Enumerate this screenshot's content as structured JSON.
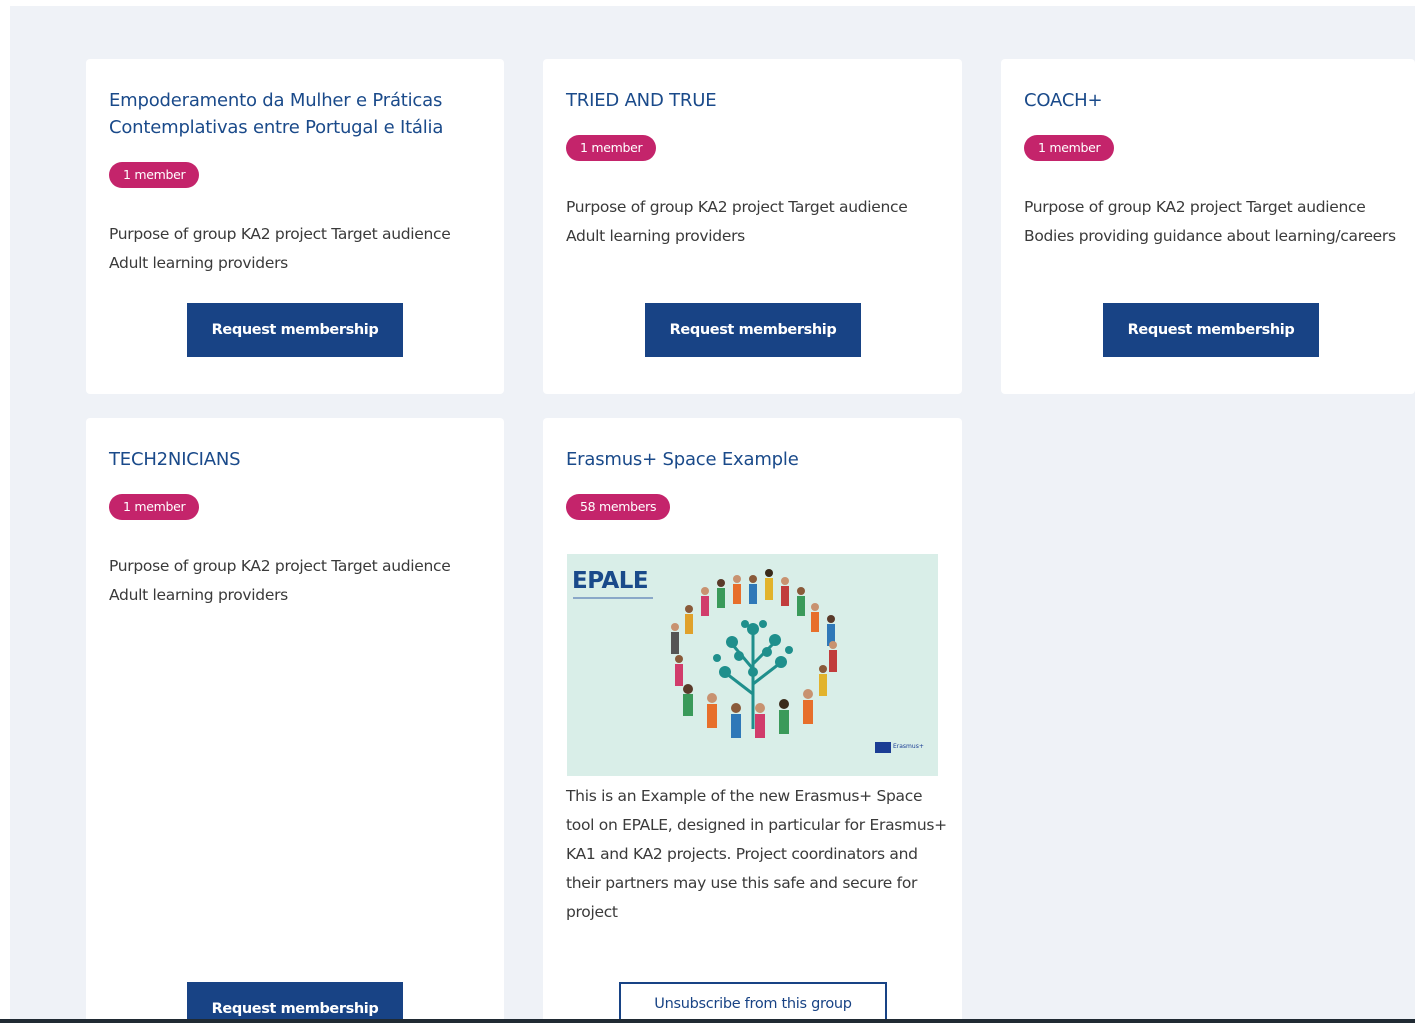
{
  "groups": [
    {
      "title": "Empoderamento da Mulher e Práticas Contemplativas entre Portugal e Itália",
      "members": "1 member",
      "description": "Purpose of group KA2 project Target audience Adult learning providers",
      "action": "Request membership"
    },
    {
      "title": "TRIED AND TRUE",
      "members": "1 member",
      "description": "Purpose of group KA2 project Target audience Adult learning providers",
      "action": "Request membership"
    },
    {
      "title": "COACH+",
      "members": "1 member",
      "description": "Purpose of group KA2 project Target audience Bodies providing guidance about learning/careers",
      "action": "Request membership"
    },
    {
      "title": "TECH2NICIANS",
      "members": "1 member",
      "description": "Purpose of group KA2 project Target audience Adult learning providers",
      "action": "Request membership"
    },
    {
      "title": "Erasmus+ Space Example",
      "members": "58 members",
      "image": {
        "logo_text": "EPALE",
        "footer_text": "Erasmus+",
        "icon": "people-tree-illustration"
      },
      "description": "This is an Example of the new Erasmus+ Space tool on EPALE, designed in particular for Erasmus+ KA1 and KA2 projects. Project coordinators and their partners may use this safe and secure for project",
      "action": "Unsubscribe from this group"
    }
  ],
  "colors": {
    "title": "#1a4a8a",
    "badge": "#c4246b",
    "button": "#184385",
    "background": "#eff2f7"
  }
}
